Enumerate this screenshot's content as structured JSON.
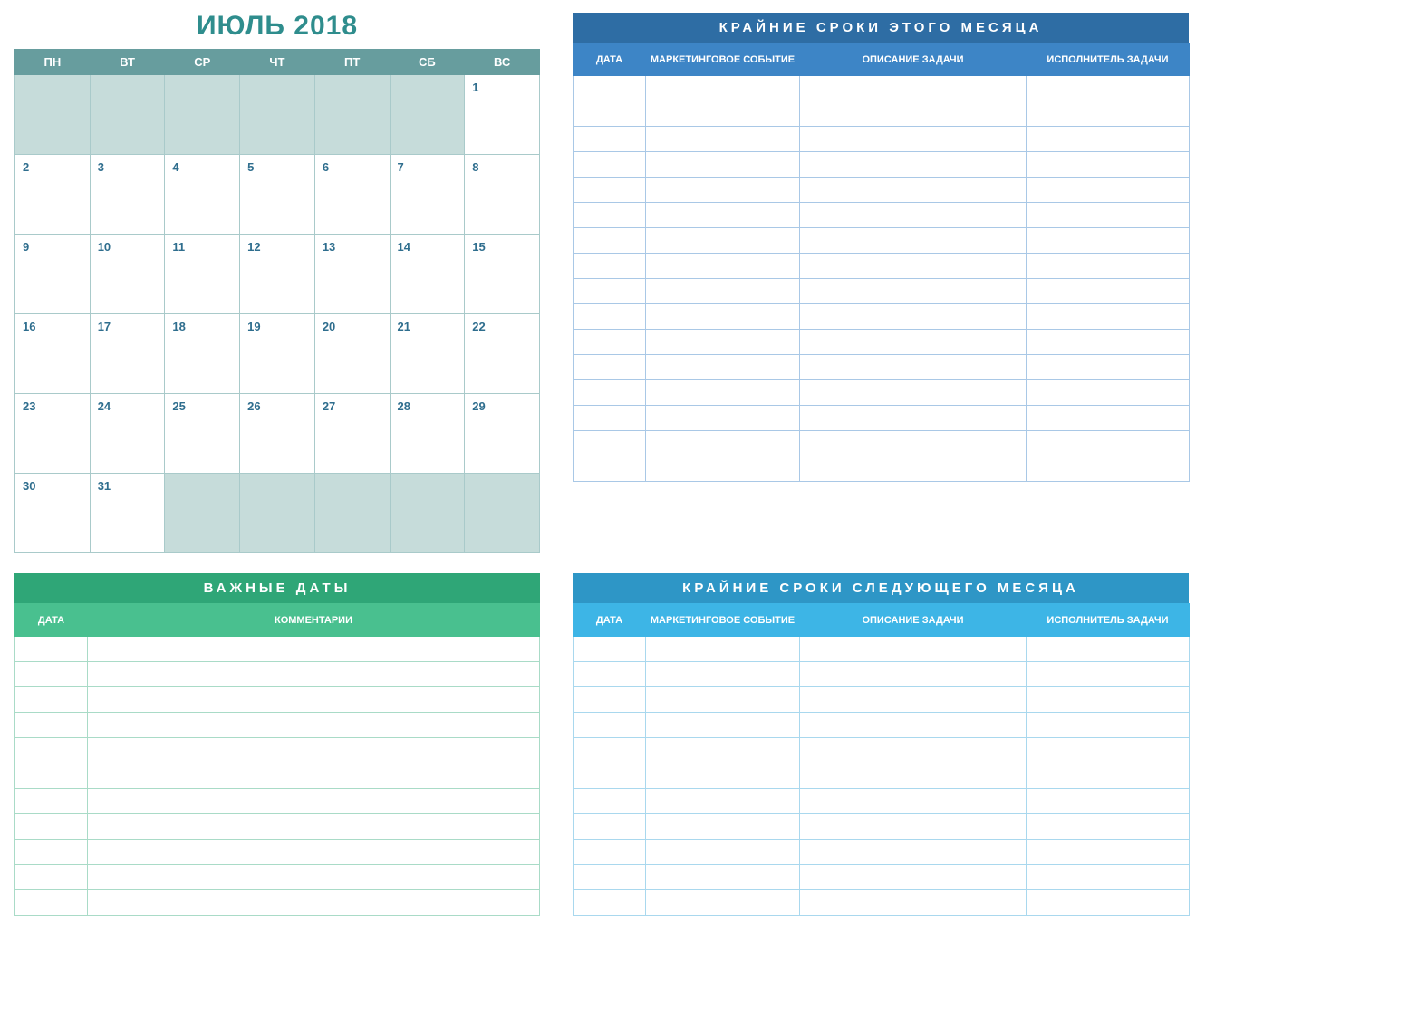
{
  "month_title": "ИЮЛЬ 2018",
  "calendar": {
    "day_headers": [
      "ПН",
      "ВТ",
      "СР",
      "ЧТ",
      "ПТ",
      "СБ",
      "ВС"
    ],
    "weeks": [
      [
        {
          "n": "",
          "pad": true
        },
        {
          "n": "",
          "pad": true
        },
        {
          "n": "",
          "pad": true
        },
        {
          "n": "",
          "pad": true
        },
        {
          "n": "",
          "pad": true
        },
        {
          "n": "",
          "pad": true
        },
        {
          "n": "1",
          "pad": false
        }
      ],
      [
        {
          "n": "2",
          "pad": false
        },
        {
          "n": "3",
          "pad": false
        },
        {
          "n": "4",
          "pad": false
        },
        {
          "n": "5",
          "pad": false
        },
        {
          "n": "6",
          "pad": false
        },
        {
          "n": "7",
          "pad": false
        },
        {
          "n": "8",
          "pad": false
        }
      ],
      [
        {
          "n": "9",
          "pad": false
        },
        {
          "n": "10",
          "pad": false
        },
        {
          "n": "11",
          "pad": false
        },
        {
          "n": "12",
          "pad": false
        },
        {
          "n": "13",
          "pad": false
        },
        {
          "n": "14",
          "pad": false
        },
        {
          "n": "15",
          "pad": false
        }
      ],
      [
        {
          "n": "16",
          "pad": false
        },
        {
          "n": "17",
          "pad": false
        },
        {
          "n": "18",
          "pad": false
        },
        {
          "n": "19",
          "pad": false
        },
        {
          "n": "20",
          "pad": false
        },
        {
          "n": "21",
          "pad": false
        },
        {
          "n": "22",
          "pad": false
        }
      ],
      [
        {
          "n": "23",
          "pad": false
        },
        {
          "n": "24",
          "pad": false
        },
        {
          "n": "25",
          "pad": false
        },
        {
          "n": "26",
          "pad": false
        },
        {
          "n": "27",
          "pad": false
        },
        {
          "n": "28",
          "pad": false
        },
        {
          "n": "29",
          "pad": false
        }
      ],
      [
        {
          "n": "30",
          "pad": false
        },
        {
          "n": "31",
          "pad": false
        },
        {
          "n": "",
          "pad": true
        },
        {
          "n": "",
          "pad": true
        },
        {
          "n": "",
          "pad": true
        },
        {
          "n": "",
          "pad": true
        },
        {
          "n": "",
          "pad": true
        }
      ]
    ]
  },
  "deadlines_this": {
    "title": "КРАЙНИЕ СРОКИ  ЭТОГО МЕСЯЦА",
    "columns": [
      "ДАТА",
      "МАРКЕТИНГОВОЕ СОБЫТИЕ",
      "ОПИСАНИЕ ЗАДАЧИ",
      "ИСПОЛНИТЕЛЬ ЗАДАЧИ"
    ],
    "row_count": 16
  },
  "important_dates": {
    "title": "ВАЖНЫЕ ДАТЫ",
    "columns": [
      "ДАТА",
      "КОММЕНТАРИИ"
    ],
    "row_count": 11
  },
  "deadlines_next": {
    "title": "КРАЙНИЕ СРОКИ  СЛЕДУЮЩЕГО МЕСЯЦА",
    "columns": [
      "ДАТА",
      "МАРКЕТИНГОВОЕ СОБЫТИЕ",
      "ОПИСАНИЕ ЗАДАЧИ",
      "ИСПОЛНИТЕЛЬ ЗАДАЧИ"
    ],
    "row_count": 11
  }
}
